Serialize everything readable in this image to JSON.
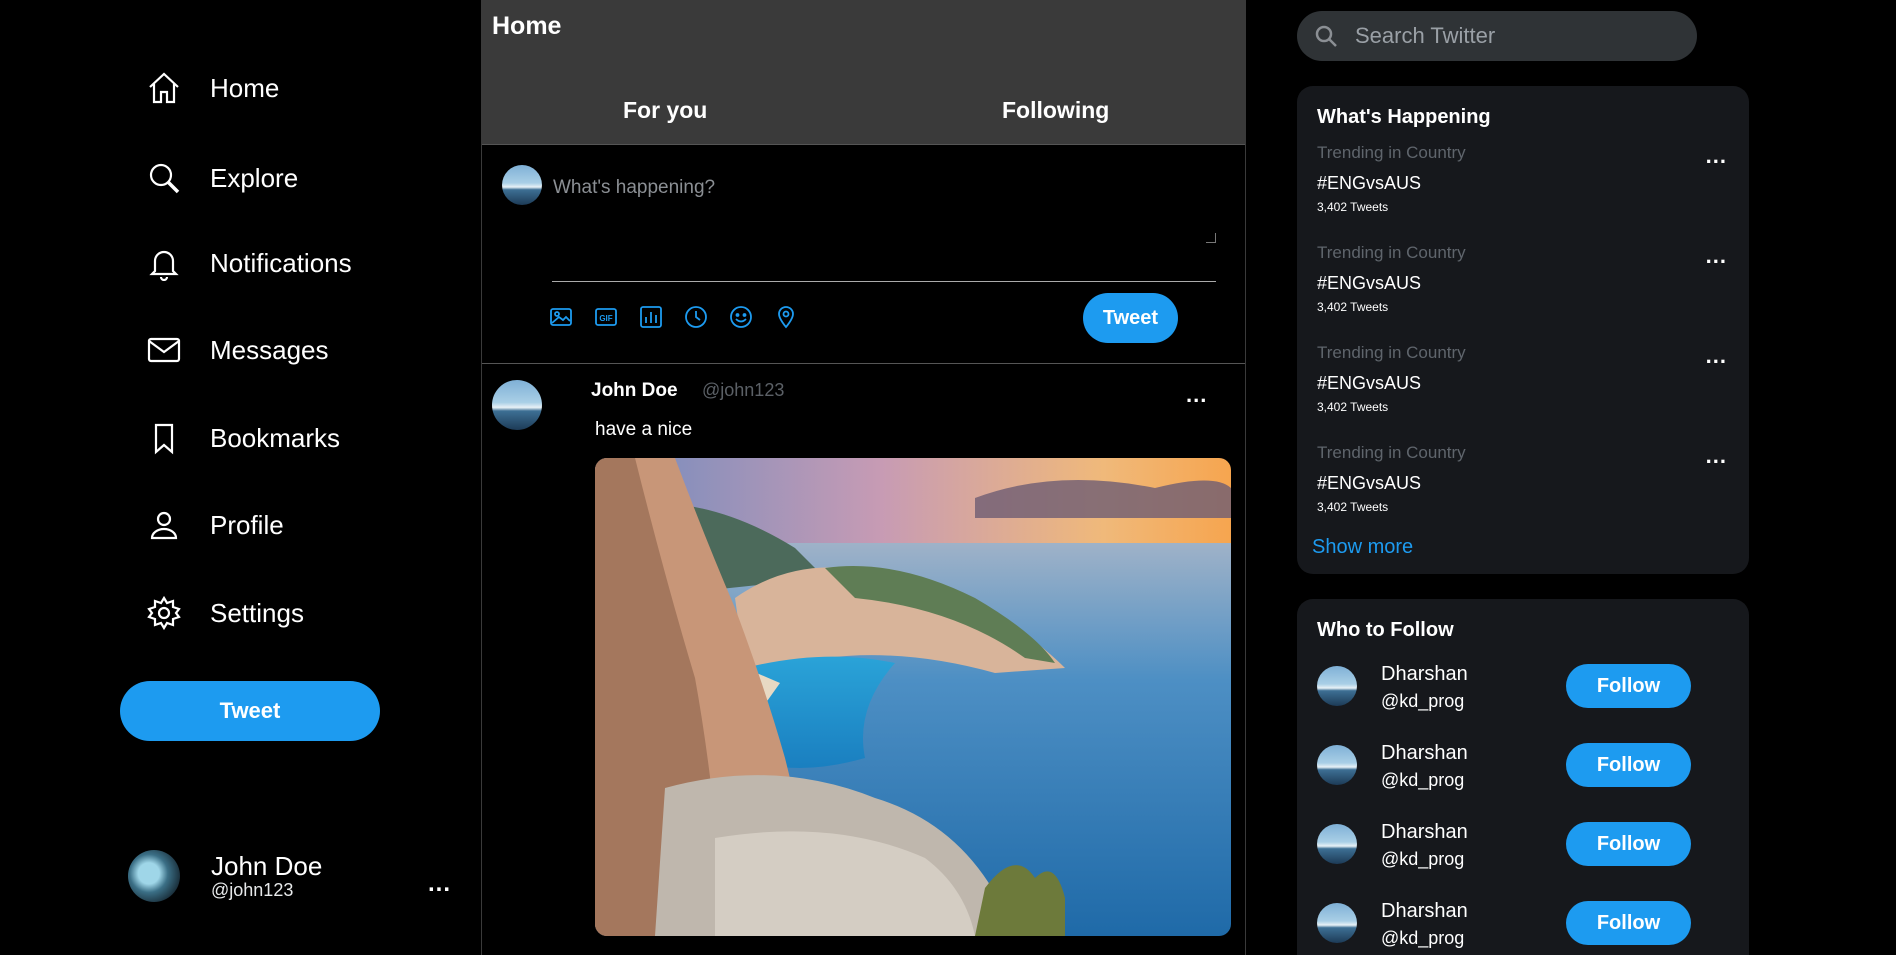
{
  "nav": {
    "items": [
      {
        "label": "Home",
        "icon": "home-icon"
      },
      {
        "label": "Explore",
        "icon": "search-icon"
      },
      {
        "label": "Notifications",
        "icon": "bell-icon"
      },
      {
        "label": "Messages",
        "icon": "envelope-icon"
      },
      {
        "label": "Bookmarks",
        "icon": "bookmark-icon"
      },
      {
        "label": "Profile",
        "icon": "person-icon"
      },
      {
        "label": "Settings",
        "icon": "gear-icon"
      }
    ],
    "tweet_button": "Tweet"
  },
  "account": {
    "name": "John Doe",
    "handle": "@john123",
    "more": "..."
  },
  "header": {
    "title": "Home",
    "tabs": [
      "For you",
      "Following"
    ]
  },
  "composer": {
    "placeholder": "What's happening?",
    "tools": [
      "image-icon",
      "gif-icon",
      "poll-icon",
      "schedule-icon",
      "emoji-icon",
      "location-icon"
    ],
    "tweet_button": "Tweet"
  },
  "post": {
    "name": "John Doe",
    "handle": "@john123",
    "text": "have a nice",
    "more": "...",
    "image": "coastal-cliffs-photo"
  },
  "search": {
    "placeholder": "Search Twitter"
  },
  "trends": {
    "title": "What's Happening",
    "items": [
      {
        "context": "Trending in Country",
        "tag": "#ENGvsAUS",
        "count": "3,402 Tweets"
      },
      {
        "context": "Trending in Country",
        "tag": "#ENGvsAUS",
        "count": "3,402 Tweets"
      },
      {
        "context": "Trending in Country",
        "tag": "#ENGvsAUS",
        "count": "3,402 Tweets"
      },
      {
        "context": "Trending in Country",
        "tag": "#ENGvsAUS",
        "count": "3,402 Tweets"
      }
    ],
    "more": "...",
    "show_more": "Show more"
  },
  "who_to_follow": {
    "title": "Who to Follow",
    "items": [
      {
        "name": "Dharshan",
        "handle": "@kd_prog",
        "button": "Follow"
      },
      {
        "name": "Dharshan",
        "handle": "@kd_prog",
        "button": "Follow"
      },
      {
        "name": "Dharshan",
        "handle": "@kd_prog",
        "button": "Follow"
      },
      {
        "name": "Dharshan",
        "handle": "@kd_prog",
        "button": "Follow"
      }
    ]
  },
  "colors": {
    "accent": "#1d9bf0",
    "background": "#000000",
    "header": "#3a3a3a",
    "card": "#16181c"
  }
}
